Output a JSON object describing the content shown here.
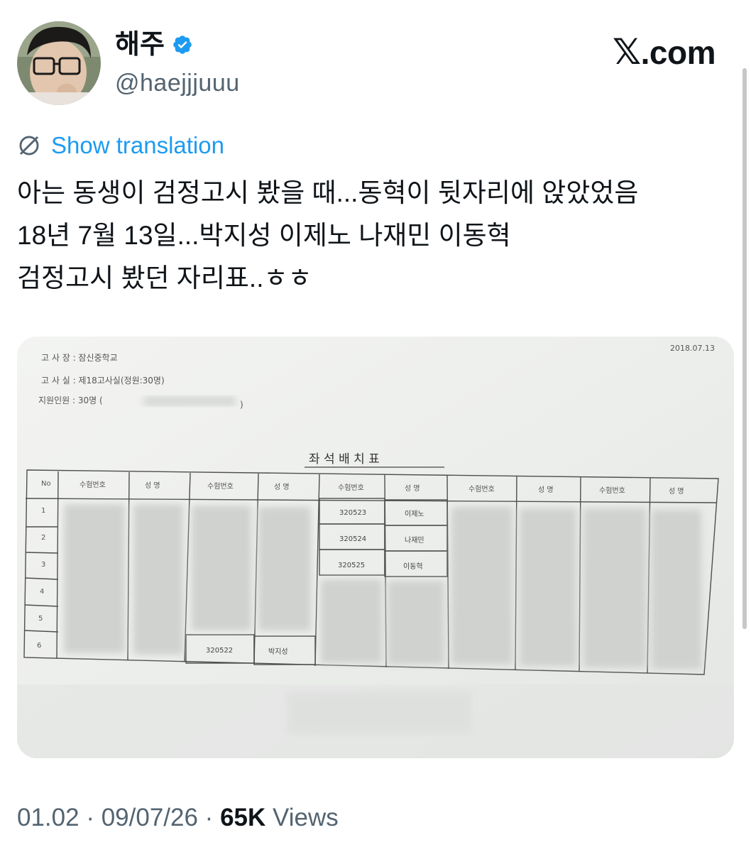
{
  "author": {
    "display_name": "해주",
    "handle": "@haejjjuuu",
    "verified_icon": "verified-badge-icon",
    "avatar_icon": "profile-photo"
  },
  "site": {
    "logo_text": "X.com",
    "logo_glyph": "𝕏",
    "logo_suffix": ".com"
  },
  "translate": {
    "label": "Show translation",
    "icon": "translate-icon"
  },
  "tweet": {
    "lines": [
      "아는 동생이 검정고시 봤을 때...동혁이 뒷자리에 앉았었음",
      "18년 7월 13일...박지성 이제노 나재민 이동혁",
      "검정고시 봤던 자리표..ㅎㅎ"
    ]
  },
  "media": {
    "date": "2018.07.13",
    "venue_label": "고 사 장 : 잠신중학교",
    "room_label": "고 사 실 : 제18고사실(정원:30명)",
    "applicants_label": "지원인원 : 30명 (",
    "applicants_close": ")",
    "title": "좌 석 배 치 표",
    "header_no": "No",
    "header_exam_no": "수험번호",
    "header_name": "성 명",
    "row_numbers": [
      "1",
      "2",
      "3",
      "4",
      "5",
      "6"
    ],
    "visible_entries": [
      {
        "exam_no": "320523",
        "name": "이제노"
      },
      {
        "exam_no": "320524",
        "name": "나재민"
      },
      {
        "exam_no": "320525",
        "name": "이동혁"
      },
      {
        "exam_no": "320522",
        "name": "박지성"
      }
    ]
  },
  "footer": {
    "time": "01.02",
    "separator": " · ",
    "date": "09/07/26",
    "views_count": "65K",
    "views_label": " Views"
  },
  "colors": {
    "link": "#1d9bf0",
    "text": "#0f1419",
    "secondary": "#536471",
    "verified": "#1d9bf0"
  }
}
